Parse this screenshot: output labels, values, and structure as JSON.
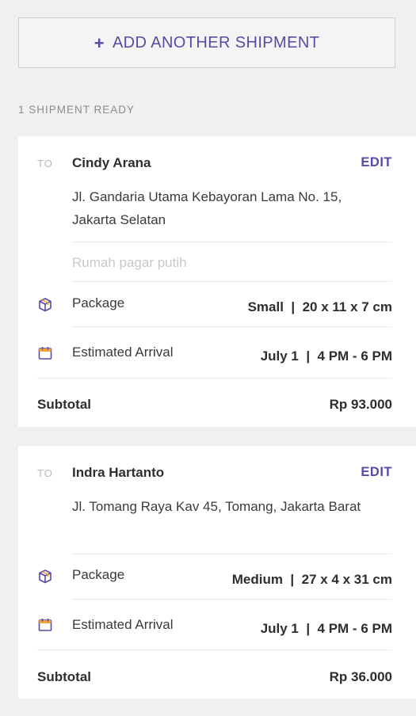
{
  "add_button": {
    "icon": "+",
    "label": "ADD ANOTHER SHIPMENT"
  },
  "status_label": "1 SHIPMENT READY",
  "shipments": [
    {
      "to_label": "TO",
      "recipient": "Cindy Arana",
      "edit_label": "EDIT",
      "address": "Jl. Gandaria Utama Kebayoran Lama No. 15, Jakarta Selatan",
      "note": "Rumah pagar putih",
      "package_label": "Package",
      "package_value": "Small  |  20 x 11 x 7 cm",
      "arrival_label": "Estimated Arrival",
      "arrival_value": "July 1  |  4 PM - 6 PM",
      "subtotal_label": "Subtotal",
      "subtotal_value": "Rp 93.000"
    },
    {
      "to_label": "TO",
      "recipient": "Indra Hartanto",
      "edit_label": "EDIT",
      "address": "Jl. Tomang Raya Kav 45, Tomang, Jakarta Barat",
      "package_label": "Package",
      "package_value": "Medium  |  27 x 4 x 31 cm",
      "arrival_label": "Estimated Arrival",
      "arrival_value": "July 1  |  4 PM - 6 PM",
      "subtotal_label": "Subtotal",
      "subtotal_value": "Rp 36.000"
    }
  ],
  "colors": {
    "accent": "#5a4aa3",
    "icon_orange": "#f2a33a",
    "background": "#f0f0f0",
    "card": "#ffffff"
  }
}
